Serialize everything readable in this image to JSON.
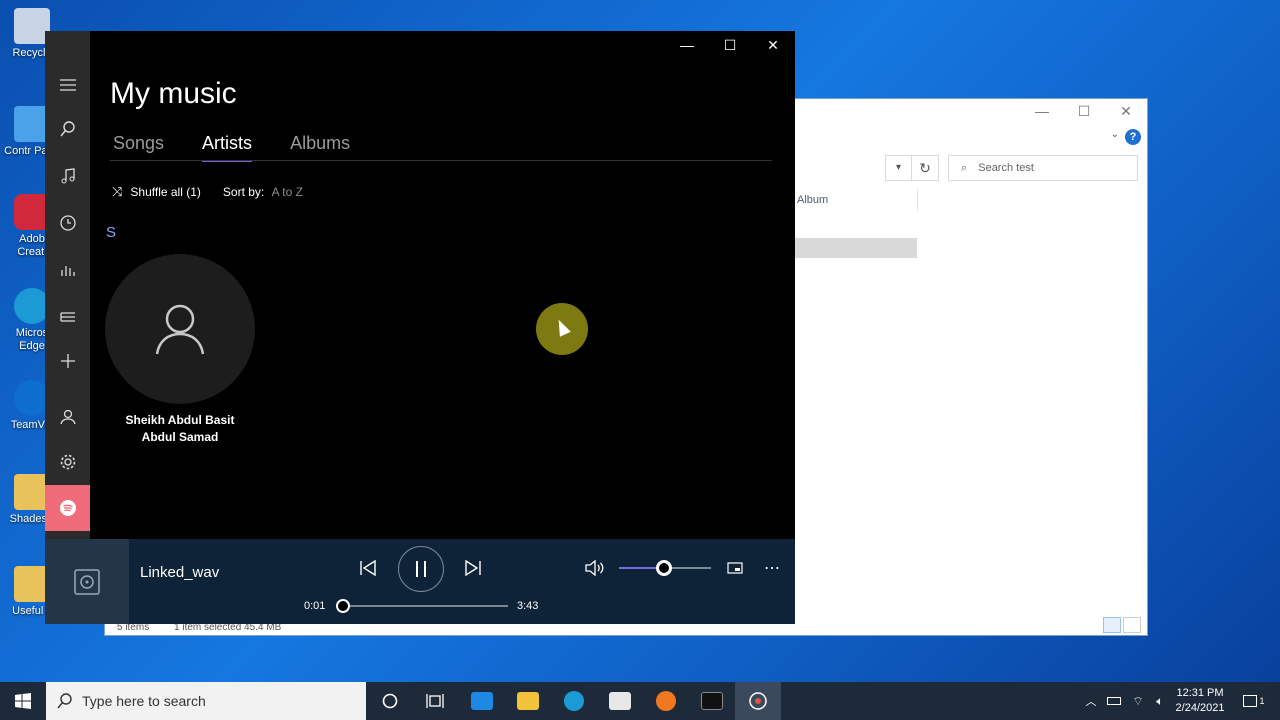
{
  "desktop": {
    "icons": [
      {
        "label": "Recycle",
        "color": "#c8d4e6"
      },
      {
        "label": "Contr Pane",
        "color": "#4aa3e8"
      },
      {
        "label": "Adob Creati",
        "color": "#d1293b"
      },
      {
        "label": "Micros Edge",
        "color": "#1c9ad6"
      },
      {
        "label": "TeamVie",
        "color": "#0e6ed0"
      },
      {
        "label": "ShadesS",
        "color": "#e8c25a"
      },
      {
        "label": "Useful c",
        "color": "#e8c25a"
      }
    ]
  },
  "explorer": {
    "search_placeholder": "Search test",
    "column_album": "Album",
    "status_items": "5 items",
    "status_selected": "1 item selected  45.4 MB",
    "help": "?"
  },
  "groove": {
    "title": "My music",
    "tabs": [
      {
        "label": "Songs",
        "active": false
      },
      {
        "label": "Artists",
        "active": true
      },
      {
        "label": "Albums",
        "active": false
      }
    ],
    "shuffle_label": "Shuffle all (1)",
    "sort_label": "Sort by:",
    "sort_value": "A to Z",
    "group_letter": "S",
    "artist": {
      "line1": "Sheikh Abdul Basit",
      "line2": "Abdul Samad"
    },
    "accent": "#6e66d9",
    "spotify_color": "#f06b7a"
  },
  "player": {
    "track": "Linked_wav",
    "elapsed": "0:01",
    "duration": "3:43",
    "progress_fraction": 0.005,
    "volume_fraction": 0.5
  },
  "taskbar": {
    "search_placeholder": "Type here to search",
    "time": "12:31 PM",
    "date": "2/24/2021",
    "notification_count": "1"
  }
}
